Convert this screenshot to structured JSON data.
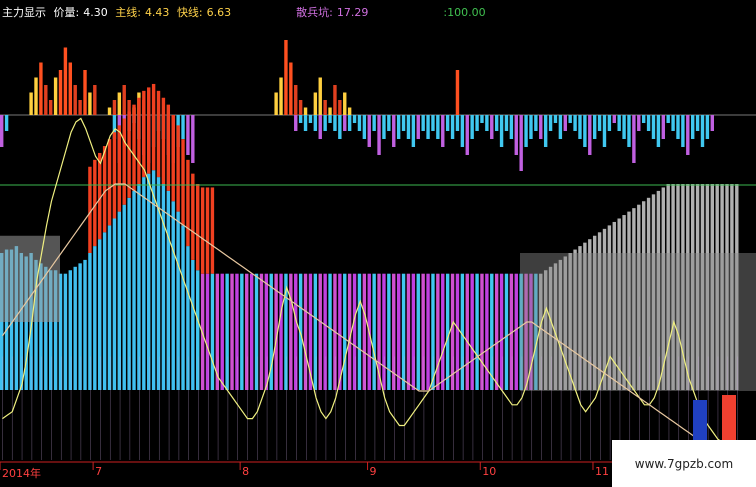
{
  "legend": {
    "title": "主力显示",
    "price_label": "价量:",
    "price_value": "4.30",
    "main_label": "主线:",
    "main_value": "4.43",
    "fast_label": "快线:",
    "fast_value": "6.63",
    "retail_label": "散兵坑:",
    "retail_value": "17.29",
    "level_value": ":100.00",
    "colors": {
      "title": "#ffffff",
      "price": "#ffffff",
      "main": "#ffd24a",
      "fast": "#ffd24a",
      "retail": "#d070e0",
      "level": "#40c050"
    }
  },
  "watermark": "www.7gpzb.com",
  "chart_data": {
    "type": "bar",
    "title": "",
    "x_ticks": [
      {
        "label": "2014年",
        "index": 0
      },
      {
        "label": "7",
        "index": 19
      },
      {
        "label": "8",
        "index": 49
      },
      {
        "label": "9",
        "index": 75
      },
      {
        "label": "10",
        "index": 98
      },
      {
        "label": "11",
        "index": 121
      }
    ],
    "ylim": [
      0,
      100
    ],
    "reference_line": 78,
    "panels": {
      "volume": {
        "ylim": [
          0,
          10
        ],
        "values": [
          0,
          0,
          0,
          0,
          0,
          0,
          3,
          5,
          7,
          4,
          2,
          5,
          6,
          9,
          7,
          4,
          2,
          6,
          3,
          4,
          0,
          0,
          1,
          2,
          3,
          4,
          2,
          1,
          3,
          2,
          0,
          0,
          0,
          0,
          0,
          0,
          0,
          0,
          0,
          0,
          0,
          0,
          0,
          0,
          0,
          0,
          0,
          0,
          0,
          0,
          0,
          0,
          0,
          0,
          0,
          0,
          3,
          5,
          10,
          7,
          4,
          2,
          1,
          0,
          3,
          5,
          2,
          1,
          4,
          2,
          3,
          1,
          0,
          0,
          0,
          0,
          0,
          0,
          0,
          0,
          0,
          0,
          0,
          0,
          0,
          0,
          0,
          0,
          0,
          0,
          0,
          0,
          0,
          6,
          0,
          0,
          0,
          0,
          0,
          0,
          0,
          0,
          0,
          0,
          0,
          0,
          0,
          0,
          0,
          0,
          0,
          0,
          0,
          0,
          0,
          0,
          0,
          0,
          0,
          0,
          0,
          0,
          0,
          0,
          0,
          0,
          0,
          0,
          0,
          0,
          0,
          0,
          0,
          0,
          0,
          0,
          0,
          0,
          0,
          0,
          0,
          0,
          0,
          0,
          0,
          0,
          0,
          0,
          0,
          0,
          0,
          0
        ]
      },
      "momentum": {
        "ylim": [
          -10,
          10
        ],
        "values": [
          -4,
          -2,
          0,
          0,
          0,
          0,
          0,
          0,
          0,
          0,
          0,
          0,
          0,
          0,
          0,
          0,
          0,
          0,
          0,
          0,
          0,
          0,
          0,
          -3,
          -6,
          -4,
          -2,
          -1,
          -3,
          -5,
          -6,
          -4,
          -2,
          -3,
          -5,
          -6,
          -4,
          -3,
          -5,
          -6,
          0,
          0,
          0,
          0,
          0,
          0,
          0,
          0,
          0,
          0,
          0,
          0,
          0,
          0,
          0,
          0,
          0,
          0,
          0,
          0,
          -2,
          -1,
          -2,
          -1,
          -2,
          -3,
          -2,
          -1,
          -2,
          -3,
          -2,
          -2,
          -1,
          -2,
          -3,
          -4,
          -2,
          -5,
          -3,
          -2,
          -4,
          -3,
          -2,
          -3,
          -4,
          -3,
          -2,
          -3,
          -2,
          -3,
          -4,
          -2,
          -3,
          -2,
          -4,
          -5,
          -3,
          -2,
          -1,
          -2,
          -3,
          -2,
          -4,
          -2,
          -3,
          -5,
          -7,
          -4,
          -3,
          -2,
          -3,
          -4,
          -2,
          -1,
          -3,
          -2,
          -1,
          -2,
          -3,
          -4,
          -5,
          -3,
          -2,
          -4,
          -2,
          -1,
          -2,
          -3,
          -4,
          -6,
          -2,
          -1,
          -2,
          -3,
          -4,
          -3,
          -1,
          -2,
          -3,
          -4,
          -5,
          -3,
          -2,
          -4,
          -3,
          -2
        ]
      },
      "main_force": {
        "values": [
          60,
          61,
          61,
          62,
          60,
          59,
          60,
          58,
          57,
          56,
          55,
          55,
          54,
          54,
          55,
          56,
          57,
          58,
          60,
          62,
          64,
          66,
          68,
          70,
          72,
          74,
          76,
          78,
          80,
          82,
          83,
          84,
          82,
          80,
          78,
          75,
          72,
          68,
          62,
          58,
          55,
          54,
          54,
          54,
          54,
          54,
          54,
          54,
          54,
          54,
          54,
          54,
          54,
          54,
          54,
          54,
          54,
          54,
          54,
          54,
          54,
          54,
          54,
          54,
          54,
          54,
          54,
          54,
          54,
          54,
          54,
          54,
          54,
          54,
          54,
          54,
          54,
          54,
          54,
          54,
          54,
          54,
          54,
          54,
          54,
          54,
          54,
          54,
          54,
          54,
          54,
          54,
          54,
          54,
          54,
          54,
          54,
          54,
          54,
          54,
          54,
          54,
          54,
          54,
          54,
          54,
          54,
          54,
          54,
          54,
          54,
          55,
          56,
          57,
          58,
          59,
          60,
          61,
          62,
          63,
          64,
          65,
          66,
          67,
          68,
          69,
          70,
          71,
          72,
          73,
          74,
          75,
          76,
          77,
          78,
          79,
          80,
          80,
          80,
          80,
          80,
          80,
          80,
          80,
          80,
          80,
          80,
          80,
          80,
          80,
          80
        ]
      },
      "fast_line": {
        "values": [
          12,
          13,
          14,
          18,
          22,
          30,
          40,
          52,
          60,
          68,
          75,
          80,
          85,
          90,
          95,
          98,
          99,
          96,
          92,
          88,
          86,
          90,
          94,
          96,
          95,
          92,
          90,
          88,
          86,
          84,
          80,
          76,
          72,
          68,
          64,
          60,
          56,
          52,
          48,
          44,
          40,
          36,
          32,
          28,
          24,
          22,
          20,
          18,
          16,
          14,
          12,
          12,
          14,
          18,
          22,
          28,
          36,
          44,
          50,
          46,
          40,
          36,
          30,
          24,
          18,
          14,
          12,
          14,
          18,
          24,
          30,
          36,
          42,
          46,
          42,
          36,
          30,
          24,
          18,
          14,
          12,
          10,
          10,
          12,
          14,
          16,
          18,
          20,
          24,
          28,
          32,
          36,
          40,
          38,
          36,
          34,
          32,
          30,
          28,
          26,
          24,
          22,
          20,
          18,
          16,
          16,
          18,
          22,
          28,
          34,
          40,
          44,
          40,
          36,
          32,
          28,
          24,
          20,
          16,
          14,
          16,
          18,
          22,
          26,
          30,
          28,
          26,
          24,
          22,
          20,
          18,
          16,
          16,
          18,
          22,
          28,
          34,
          40,
          36,
          30,
          24,
          20,
          16,
          12,
          10,
          8,
          6,
          5,
          5,
          5
        ]
      },
      "slow_line": {
        "values": [
          36,
          38,
          40,
          42,
          44,
          46,
          48,
          50,
          52,
          54,
          56,
          58,
          60,
          62,
          64,
          66,
          68,
          70,
          72,
          74,
          76,
          78,
          79,
          80,
          80,
          80,
          79,
          78,
          77,
          76,
          75,
          74,
          73,
          72,
          71,
          70,
          69,
          68,
          67,
          66,
          65,
          64,
          63,
          62,
          61,
          60,
          59,
          58,
          57,
          56,
          55,
          54,
          53,
          52,
          51,
          50,
          49,
          48,
          47,
          46,
          45,
          44,
          43,
          42,
          41,
          40,
          39,
          38,
          37,
          36,
          35,
          34,
          33,
          32,
          31,
          30,
          29,
          28,
          27,
          26,
          25,
          24,
          23,
          22,
          21,
          20,
          20,
          20,
          21,
          22,
          23,
          24,
          25,
          26,
          27,
          28,
          29,
          30,
          31,
          32,
          33,
          34,
          35,
          36,
          37,
          38,
          39,
          40,
          40,
          39,
          38,
          37,
          36,
          35,
          34,
          33,
          32,
          31,
          30,
          29,
          28,
          27,
          26,
          25,
          24,
          23,
          22,
          21,
          20,
          19,
          18,
          17,
          16,
          15,
          14,
          13,
          12,
          11,
          10,
          9,
          8,
          7,
          6,
          5,
          4,
          3,
          2,
          1,
          0,
          0
        ]
      }
    }
  }
}
